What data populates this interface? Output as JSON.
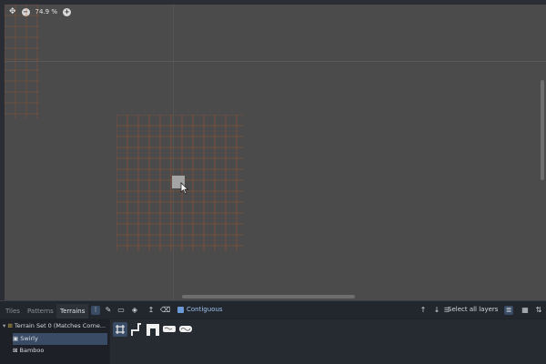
{
  "viewport": {
    "zoom_label": "74.9 %",
    "zoom_out_icon": "minus-circle-icon",
    "zoom_in_icon": "plus-circle-icon",
    "center_icon": "center-view-icon"
  },
  "panel": {
    "tabs": [
      {
        "label": "Tiles",
        "active": false
      },
      {
        "label": "Patterns",
        "active": false
      },
      {
        "label": "Terrains",
        "active": true
      }
    ],
    "tools": [
      "select-tool-icon",
      "paint-brush-icon",
      "line-tool-icon",
      "rect-tool-icon",
      "bucket-fill-icon",
      "picker-icon",
      "eraser-icon"
    ],
    "contiguous_label": "Contiguous",
    "contiguous_checked": true,
    "select_all_layers_label": "Select all layers",
    "tree": {
      "terrain_set": "Terrain Set 0 (Matches Corne...",
      "terrains": [
        {
          "label": "Swirly",
          "selected": true
        },
        {
          "label": "Bamboo",
          "selected": false
        }
      ]
    }
  },
  "colors": {
    "grid_orange": "#b5562a",
    "accent": "#6a9bd8"
  }
}
